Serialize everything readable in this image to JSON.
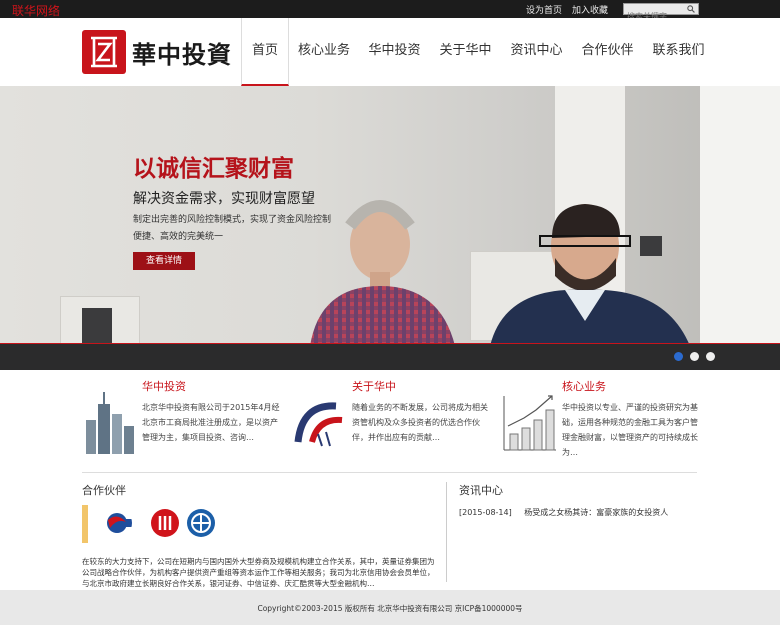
{
  "topbar": {
    "brand_tag": "联华网络",
    "set_home": "设为首页",
    "add_favorite": "加入收藏",
    "search_placeholder": "搜索关键字"
  },
  "header": {
    "logo_text": "華中投資"
  },
  "nav": {
    "items": [
      "首页",
      "核心业务",
      "华中投资",
      "关于华中",
      "资讯中心",
      "合作伙伴",
      "联系我们"
    ],
    "active_index": 0
  },
  "hero": {
    "headline": "以诚信汇聚财富",
    "subheadline": "解决资金需求，实现财富愿望",
    "desc_line1": "制定出完善的风险控制模式，实现了资金风险控制",
    "desc_line2": "便捷、高效的完美统一",
    "button": "查看详情",
    "slides": 3,
    "active_slide": 0
  },
  "features": [
    {
      "title": "华中投资",
      "text": "北京华中投资有限公司于2015年4月经北京市工商局批准注册成立，是以资产管理为主，集项目投资、咨询…",
      "icon": "city-buildings-icon"
    },
    {
      "title": "关于华中",
      "text": "随着业务的不断发展，公司将成为相关资管机构及众多投资者的优选合作伙伴，并作出应有的贡献…",
      "icon": "arch-logo-icon"
    },
    {
      "title": "核心业务",
      "text": "华中投资以专业、严谨的投资研究为基础，运用各种规范的金融工具为客户管理金融财富，以管理资产的可持续成长为…",
      "icon": "growth-chart-icon"
    }
  ],
  "partners": {
    "title": "合作伙伴",
    "logos": [
      "partner-logo-red-blue",
      "partner-logo-red-circle",
      "partner-logo-blue-circle"
    ],
    "about": "在较东的大力支持下，公司在短期内与国内国外大型券商及规模机构建立合作关系，其中，英量证券集团为公司战略合作伙伴，为机构客户提供资产重组等资本运作工作等相关服务；我司为北京信用协会会员单位，与北京市政府建立长期良好合作关系，银河证券、中信证券、庆汇酷贯等大型金融机构…"
  },
  "news": {
    "title": "资讯中心",
    "items": [
      {
        "date": "[2015-08-14]",
        "headline": "杨受成之女杨其诗：富豪家族的女投资人"
      }
    ]
  },
  "footer": {
    "copyright": "Copyright©2003-2015 版权所有 北京华中投资有限公司 京ICP备1000000号"
  },
  "colors": {
    "brand_red": "#c8141b",
    "button_red": "#9d1016",
    "topbar": "#1c1c1c",
    "dot_active": "#2b6bd0"
  }
}
